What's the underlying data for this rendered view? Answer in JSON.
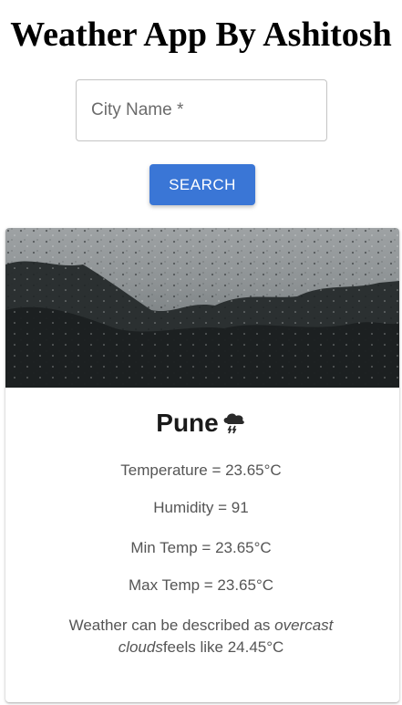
{
  "app": {
    "title": "Weather App By Ashitosh"
  },
  "search": {
    "placeholder": "City Name *",
    "value": "",
    "button_label": "SEARCH"
  },
  "result": {
    "image_icon": "rainy-window-image",
    "city": "Pune",
    "city_icon": "storm-cloud-icon",
    "temperature": "Temperature = 23.65°C",
    "humidity": "Humidity = 91",
    "min_temp": "Min Temp = 23.65°C",
    "max_temp": "Max Temp = 23.65°C",
    "description_prefix": "Weather can be described as ",
    "description_condition": "overcast clouds",
    "description_suffix": "feels like 24.45°C"
  },
  "colors": {
    "accent": "#3a76d6",
    "text_secondary": "#555555",
    "border": "#c4c4c4"
  }
}
